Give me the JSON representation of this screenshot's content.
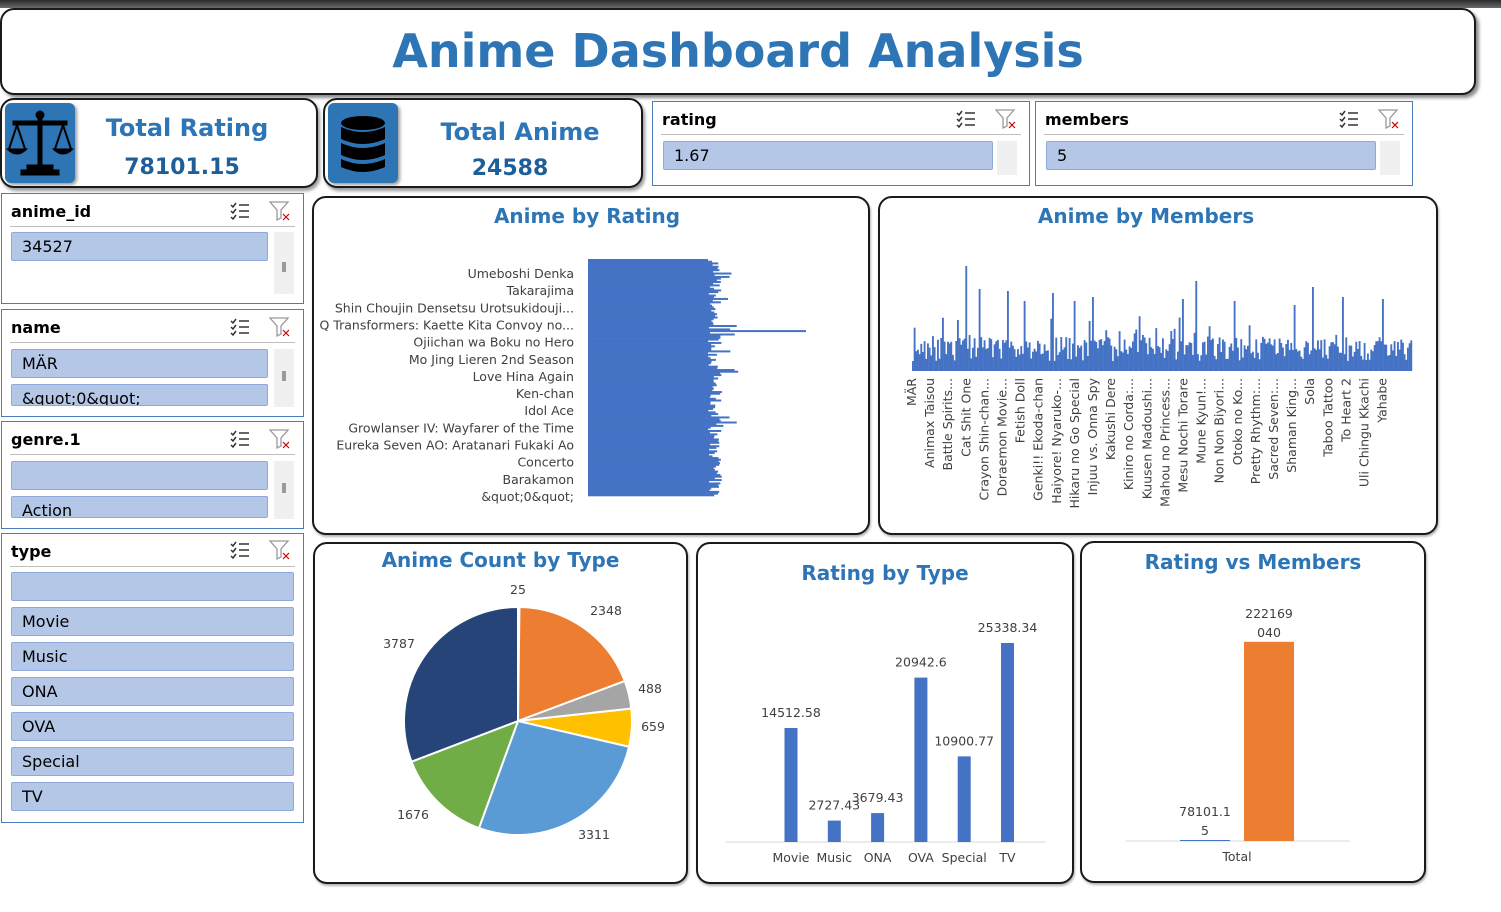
{
  "title": "Anime Dashboard Analysis",
  "kpis": {
    "rating": {
      "label": "Total Rating",
      "value": "78101.15",
      "icon": "scale-icon"
    },
    "anime": {
      "label": "Total Anime",
      "value": "24588",
      "icon": "database-icon"
    }
  },
  "slicers": {
    "rating": {
      "header": "rating",
      "items": [
        "1.67"
      ]
    },
    "members": {
      "header": "members",
      "items": [
        "5"
      ]
    },
    "anime_id": {
      "header": "anime_id",
      "items": [
        "34527"
      ]
    },
    "name": {
      "header": "name",
      "items": [
        "MÄR",
        "&quot;0&quot;"
      ]
    },
    "genre": {
      "header": "genre.1",
      "items": [
        "",
        "Action"
      ]
    },
    "type": {
      "header": "type",
      "items": [
        "",
        "Movie",
        "Music",
        "ONA",
        "OVA",
        "Special",
        "TV"
      ]
    }
  },
  "charts": {
    "by_rating": {
      "title": "Anime by Rating",
      "labels": [
        "Umeboshi Denka",
        "Takarajima",
        "Shin Choujin Densetsu Urotsukidouji...",
        "Q Transformers: Kaette Kita Convoy no...",
        "Ojiichan wa Boku no Hero",
        "Mo Jing Lieren 2nd Season",
        "Love Hina Again",
        "Ken-chan",
        "Idol Ace",
        "Growlanser IV: Wayfarer of the Time",
        "Eureka Seven AO: Aratanari Fukaki Ao",
        "Concerto",
        "Barakamon",
        "&quot;0&quot;"
      ]
    },
    "by_members": {
      "title": "Anime by Members",
      "labels": [
        "MÄR",
        "Animax Taisou",
        "Battle Spirits...",
        "Cat Shit One",
        "Crayon Shin-chan...",
        "Doraemon Movie...",
        "Fetish Doll",
        "Genki!! Ekoda-chan",
        "Haiyore! Nyaruko-...",
        "Hikaru no Go Special",
        "Injuu vs. Onna Spy",
        "Kakushi Dere",
        "Kiniro no Corda:...",
        "Kuusen Madoushi...",
        "Mahou no Princess...",
        "Mesu Nochi Torare",
        "Mune Kyun!...",
        "Non Non Biyori...",
        "Otoko no Ko...",
        "Pretty Rhythm:...",
        "Sacred Seven:...",
        "Shaman King...",
        "Sola",
        "Taboo Tattoo",
        "To Heart 2",
        "Uli Chingu Kkachi",
        "Yahabe"
      ]
    }
  },
  "chart_data": [
    {
      "type": "pie",
      "title": "Anime Count by Type",
      "categories": [
        "(blank)",
        "Movie",
        "Music",
        "ONA",
        "OVA",
        "Special",
        "TV"
      ],
      "values": [
        25,
        2348,
        488,
        659,
        3311,
        1676,
        3787
      ],
      "colors": [
        "#4472c4",
        "#ed7d31",
        "#a5a5a5",
        "#ffc000",
        "#5b9bd5",
        "#70ad47",
        "#264478"
      ],
      "data_labels": [
        "25",
        "2348",
        "488",
        "659",
        "3311",
        "1676",
        "3787"
      ]
    },
    {
      "type": "bar",
      "title": "Rating by Type",
      "categories": [
        "Movie",
        "Music",
        "ONA",
        "OVA",
        "Special",
        "TV"
      ],
      "values": [
        14512.58,
        2727.43,
        3679.43,
        20942.6,
        10900.77,
        25338.34
      ],
      "data_labels": [
        "14512.58",
        "2727.43",
        "3679.43",
        "20942.6",
        "10900.77",
        "25338.34"
      ],
      "ylim": [
        0,
        27000
      ],
      "color": "#4472c4"
    },
    {
      "type": "bar",
      "title": "Rating vs Members",
      "categories": [
        "Total"
      ],
      "series": [
        {
          "name": "rating",
          "values": [
            78101.15
          ],
          "color": "#4472c4",
          "label_lines": [
            "78101.1",
            "5"
          ]
        },
        {
          "name": "members",
          "values": [
            222169040
          ],
          "color": "#ed7d31",
          "label_lines": [
            "222169",
            "040"
          ]
        }
      ],
      "ylim": [
        0,
        290000000
      ]
    }
  ]
}
